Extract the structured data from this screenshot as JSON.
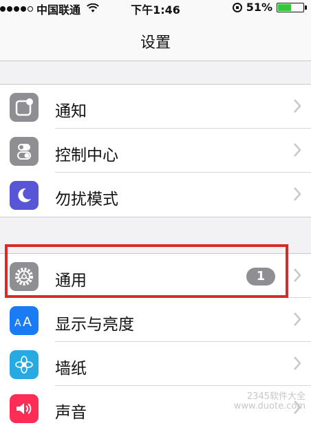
{
  "status_bar": {
    "carrier": "中国联通",
    "time": "下午1:46",
    "battery_text": "51%",
    "battery_level": 0.51
  },
  "nav": {
    "title": "设置"
  },
  "groups": [
    {
      "rows": [
        {
          "label": "通知",
          "icon": "notifications-icon",
          "icon_color": "#8e8e93"
        },
        {
          "label": "控制中心",
          "icon": "control-center-icon",
          "icon_color": "#8e8e93"
        },
        {
          "label": "勿扰模式",
          "icon": "do-not-disturb-moon-icon",
          "icon_color": "#5856d6"
        }
      ]
    },
    {
      "rows": [
        {
          "label": "通用",
          "icon": "gear-icon",
          "icon_color": "#8e8e93",
          "badge": "1"
        },
        {
          "label": "显示与亮度",
          "icon": "display-aa-icon",
          "icon_color": "#1a7cf5"
        },
        {
          "label": "墙纸",
          "icon": "wallpaper-flower-icon",
          "icon_color": "#27aae1"
        },
        {
          "label": "声音",
          "icon": "sound-speaker-icon",
          "icon_color": "#ff2d55"
        }
      ]
    }
  ],
  "watermark": {
    "line1": "2345软件大全",
    "line2": "www.duote.com"
  },
  "colors": {
    "highlight": "#d52b2b",
    "badge": "#8e8e93",
    "separator": "#c8c8cc"
  }
}
